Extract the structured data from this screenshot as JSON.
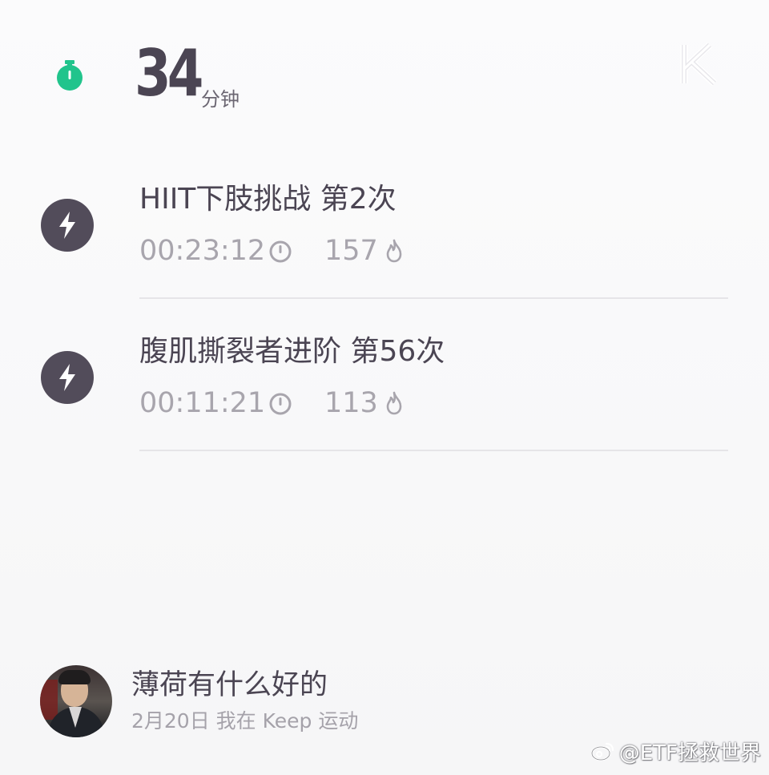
{
  "header": {
    "duration_value": "34",
    "duration_unit": "分钟",
    "accent_color": "#21c48c",
    "timer_icon": "stopwatch-icon",
    "logo": "keep-logo"
  },
  "workouts": [
    {
      "title": "HIIT下肢挑战 第2次",
      "duration": "00:23:12",
      "calories": "157",
      "icon": "lightning-icon"
    },
    {
      "title": "腹肌撕裂者进阶 第56次",
      "duration": "00:11:21",
      "calories": "113",
      "icon": "lightning-icon"
    }
  ],
  "user": {
    "name": "薄荷有什么好的",
    "meta": "2月20日 我在 Keep 运动"
  },
  "watermark": {
    "text": "@ETF拯救世界",
    "icon": "weibo-icon"
  },
  "colors": {
    "text_dark": "#4b4553",
    "text_muted": "#a8a5ad",
    "icon_bg": "#524c5a"
  }
}
